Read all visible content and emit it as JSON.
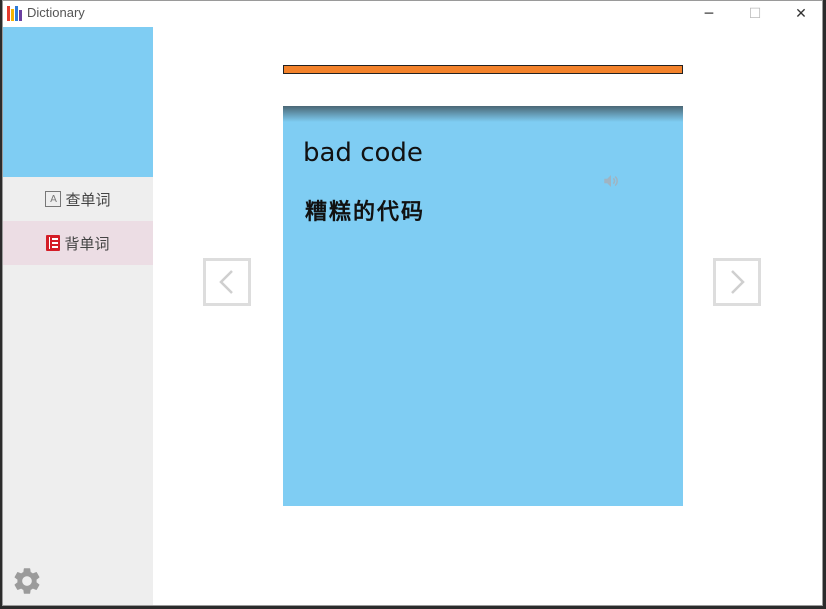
{
  "window": {
    "title": "Dictionary",
    "controls": {
      "minimize": "─",
      "maximize": "☐",
      "close": "✕"
    }
  },
  "sidebar": {
    "items": [
      {
        "label": "查单词",
        "icon": "search-word-icon"
      },
      {
        "label": "背单词",
        "icon": "notebook-icon"
      }
    ],
    "active_index": 1,
    "settings_icon": "gear-icon"
  },
  "progress": {
    "value": 1.0,
    "color": "#f3822b"
  },
  "card": {
    "word": "bad code",
    "meaning": "糟糕的代码",
    "speaker_icon": "speaker-icon"
  },
  "navigation": {
    "prev_icon": "chevron-left-icon",
    "next_icon": "chevron-right-icon"
  },
  "colors": {
    "accent_blue": "#7fcdf3",
    "active_item_bg": "#ecdde4",
    "book_red": "#d41d27",
    "progress_orange": "#f3822b"
  }
}
